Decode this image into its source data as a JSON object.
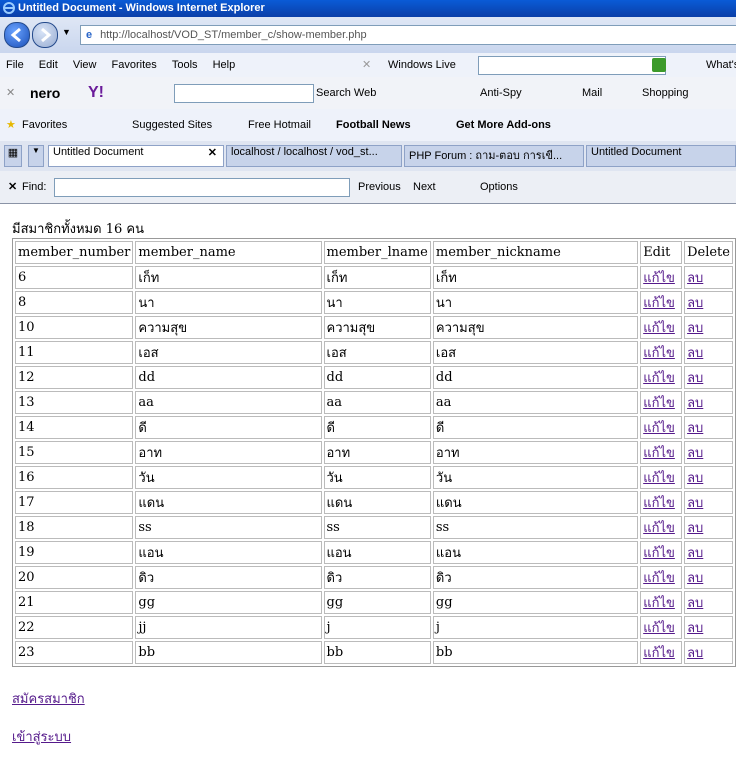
{
  "window": {
    "title": "Untitled Document - Windows Internet Explorer"
  },
  "address": {
    "url": "http://localhost/VOD_ST/member_c/show-member.php"
  },
  "menu": [
    "File",
    "Edit",
    "View",
    "Favorites",
    "Tools",
    "Help"
  ],
  "toolbar": {
    "windows_live": "Windows Live",
    "whats": "What's",
    "search_web": "Search Web",
    "anti_spy": "Anti-Spy",
    "mail": "Mail",
    "shopping": "Shopping"
  },
  "favorites": {
    "favorites": "Favorites",
    "suggested": "Suggested Sites",
    "hotmail": "Free Hotmail",
    "football": "Football News",
    "addons": "Get More Add-ons"
  },
  "tabs": [
    "Untitled Document",
    "localhost / localhost / vod_st...",
    "PHP Forum : ถาม-ตอบ การเขี...",
    "Untitled Document"
  ],
  "find": {
    "label": "Find:",
    "previous": "Previous",
    "next": "Next",
    "options": "Options"
  },
  "page": {
    "count_text": "มีสมาชิกทั้งหมด 16 คน",
    "headers": [
      "member_number",
      "member_name",
      "member_lname",
      "member_nickname",
      "Edit",
      "Delete"
    ],
    "rows": [
      [
        "6",
        "เก็ท",
        "เก็ท",
        "เก็ท"
      ],
      [
        "8",
        "นา",
        "นา",
        "นา"
      ],
      [
        "10",
        "ความสุข",
        "ความสุข",
        "ความสุข"
      ],
      [
        "11",
        "เอส",
        "เอส",
        "เอส"
      ],
      [
        "12",
        "dd",
        "dd",
        "dd"
      ],
      [
        "13",
        "aa",
        "aa",
        "aa"
      ],
      [
        "14",
        "ดี",
        "ดี",
        "ดี"
      ],
      [
        "15",
        "อาท",
        "อาท",
        "อาท"
      ],
      [
        "16",
        "วัน",
        "วัน",
        "วัน"
      ],
      [
        "17",
        "แดน",
        "แดน",
        "แดน"
      ],
      [
        "18",
        "ss",
        "ss",
        "ss"
      ],
      [
        "19",
        "แอน",
        "แอน",
        "แอน"
      ],
      [
        "20",
        "ดิว",
        "ดิว",
        "ดิว"
      ],
      [
        "21",
        "gg",
        "gg",
        "gg"
      ],
      [
        "22",
        "jj",
        "j",
        "j"
      ],
      [
        "23",
        "bb",
        "bb",
        "bb"
      ]
    ],
    "edit_label": "แก้ไข",
    "delete_label": "ลบ",
    "register_link": "สมัครสมาชิก",
    "login_link": "เข้าสู่ระบบ"
  }
}
